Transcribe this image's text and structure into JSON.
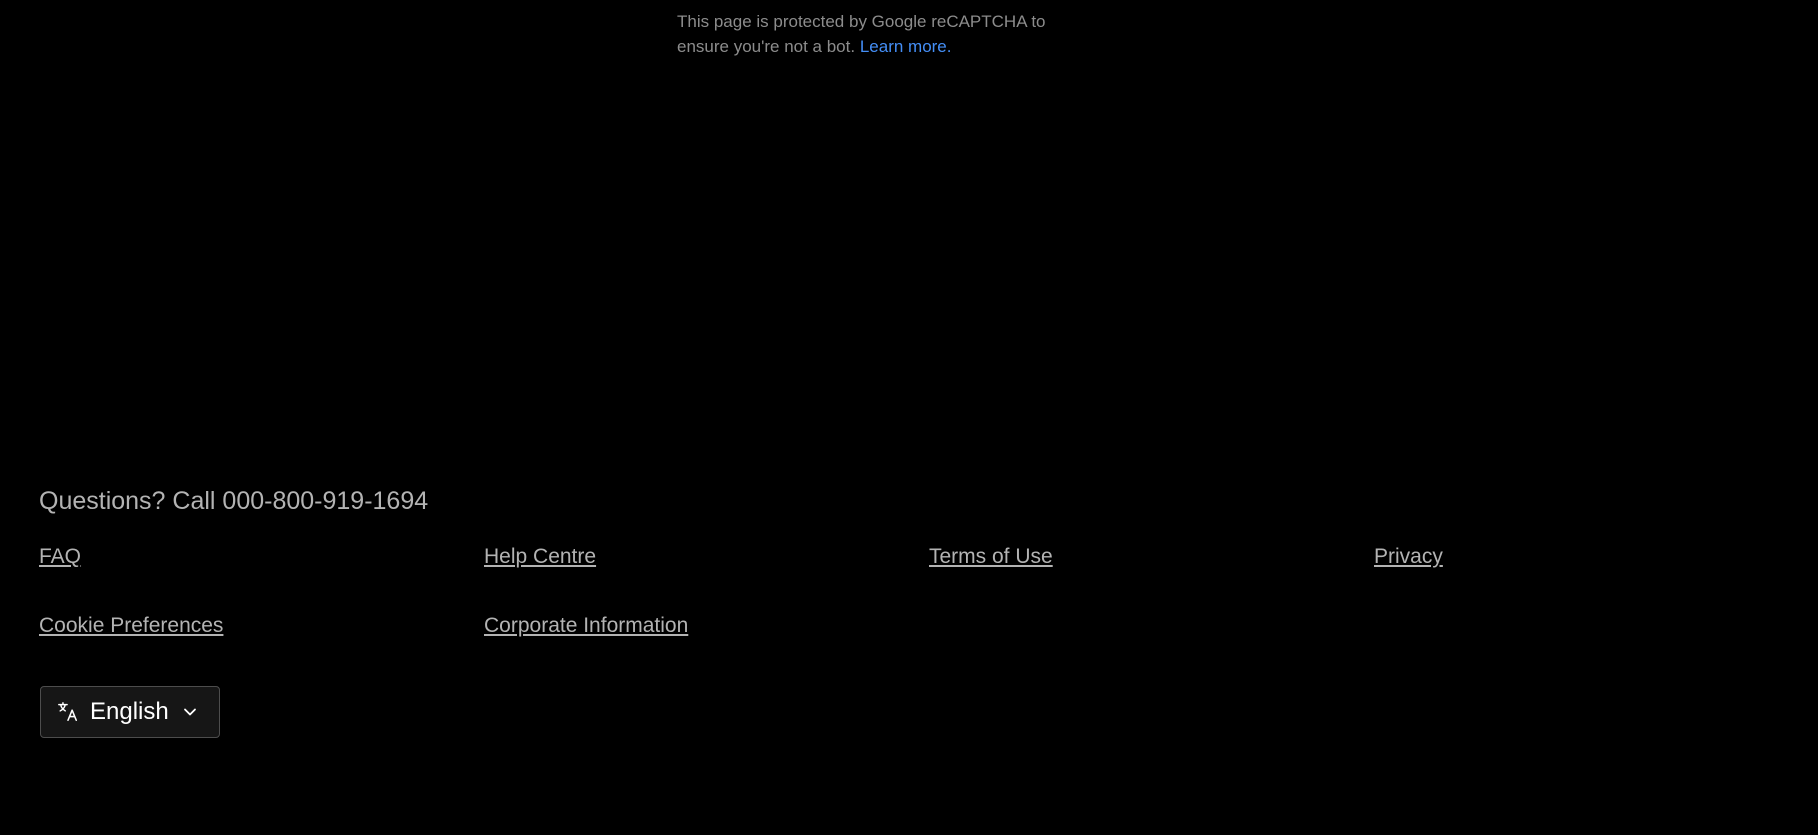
{
  "recaptcha": {
    "text": "This page is protected by Google reCAPTCHA to ensure you're not a bot.",
    "learn_more": "Learn more."
  },
  "footer": {
    "questions": "Questions? Call 000-800-919-1694",
    "links": [
      "FAQ",
      "Help Centre",
      "Terms of Use",
      "Privacy",
      "Cookie Preferences",
      "Corporate Information"
    ],
    "language": {
      "selected": "English",
      "icon": "translate-icon",
      "chevron_icon": "chevron-down-icon"
    }
  },
  "colors": {
    "background": "#000000",
    "text_muted": "#b3b3b3",
    "link_blue": "#448ef6"
  }
}
